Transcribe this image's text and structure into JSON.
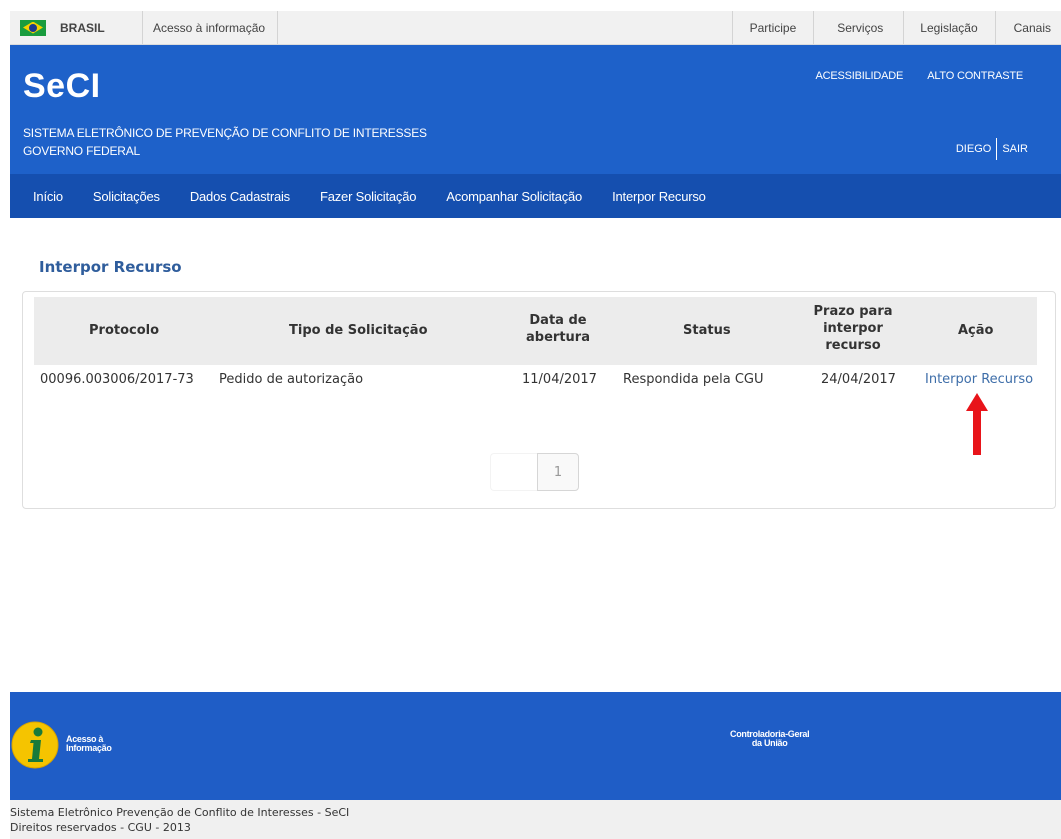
{
  "gov_bar": {
    "country": "BRASIL",
    "access_info": "Acesso à informação",
    "links": [
      "Participe",
      "Serviços",
      "Legislação",
      "Canais"
    ]
  },
  "header": {
    "logo": "SeCI",
    "subtitle_line1": "SISTEMA ELETRÔNICO DE PREVENÇÃO DE CONFLITO DE INTERESSES",
    "subtitle_line2": "GOVERNO FEDERAL",
    "accessibility": "ACESSIBILIDADE",
    "high_contrast": "ALTO CONTRASTE",
    "user": "DIEGO",
    "logout": "SAIR"
  },
  "nav": {
    "items": [
      "Início",
      "Solicitações",
      "Dados Cadastrais",
      "Fazer Solicitação",
      "Acompanhar Solicitação",
      "Interpor Recurso"
    ]
  },
  "main": {
    "title": "Interpor Recurso",
    "table": {
      "headers": {
        "protocolo": "Protocolo",
        "tipo": "Tipo de Solicitação",
        "data_l1": "Data de",
        "data_l2": "abertura",
        "status": "Status",
        "prazo_l1": "Prazo para",
        "prazo_l2": "interpor",
        "prazo_l3": "recurso",
        "acao": "Ação"
      },
      "rows": [
        {
          "protocolo": "00096.003006/2017-73",
          "tipo": "Pedido de autorização",
          "data": "11/04/2017",
          "status": "Respondida pela CGU",
          "prazo": "24/04/2017",
          "acao": "Interpor Recurso"
        }
      ]
    },
    "pagination": {
      "current": "1"
    }
  },
  "footer": {
    "ai_line1": "Acesso à",
    "ai_line2": "Informação",
    "cgu_line1": "Controladoria-Geral",
    "cgu_line2": "da União",
    "copyright_line1": "Sistema Eletrônico Prevenção de Conflito de Interesses - SeCI",
    "copyright_line2": "Direitos reservados - CGU - 2013"
  },
  "colors": {
    "header_blue": "#1e61c9",
    "nav_blue": "#154faf",
    "link_blue": "#3e6ea9",
    "arrow_red": "#e8141a"
  }
}
